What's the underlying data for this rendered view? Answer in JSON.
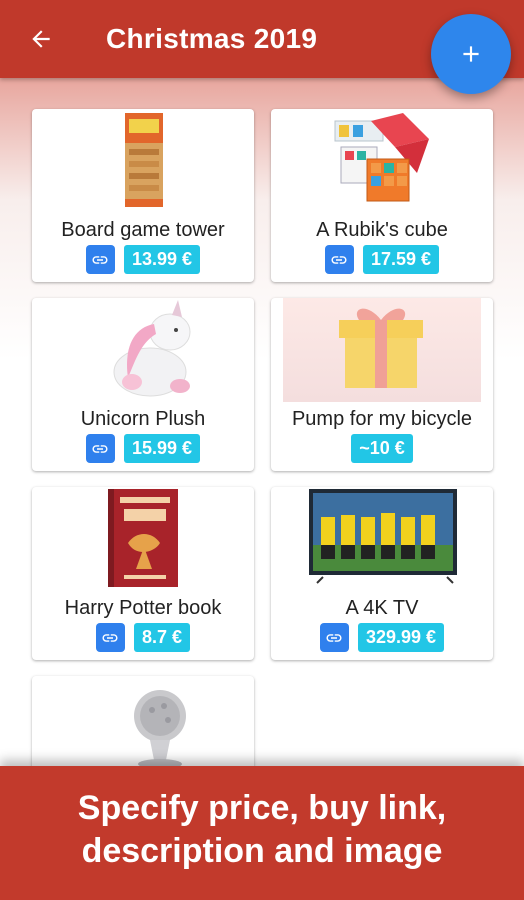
{
  "appbar": {
    "title": "Christmas 2019",
    "back_icon": "arrow-left-icon",
    "add_icon": "plus-icon"
  },
  "items": [
    {
      "name": "Board game tower",
      "price": "13.99 €",
      "has_link": true
    },
    {
      "name": "A Rubik's cube",
      "price": "17.59 €",
      "has_link": true
    },
    {
      "name": "Unicorn Plush",
      "price": "15.99 €",
      "has_link": true
    },
    {
      "name": "Pump for my bicycle",
      "price": "~10 €",
      "has_link": false
    },
    {
      "name": "Harry Potter book",
      "price": "8.7 €",
      "has_link": true
    },
    {
      "name": "A 4K TV",
      "price": "329.99 €",
      "has_link": true
    }
  ],
  "banner": {
    "line1": "Specify price, buy link,",
    "line2": "description and image"
  },
  "colors": {
    "primary": "#c0392b",
    "fab": "#2e86ec",
    "link": "#2f80ed",
    "price": "#22c6e6"
  }
}
